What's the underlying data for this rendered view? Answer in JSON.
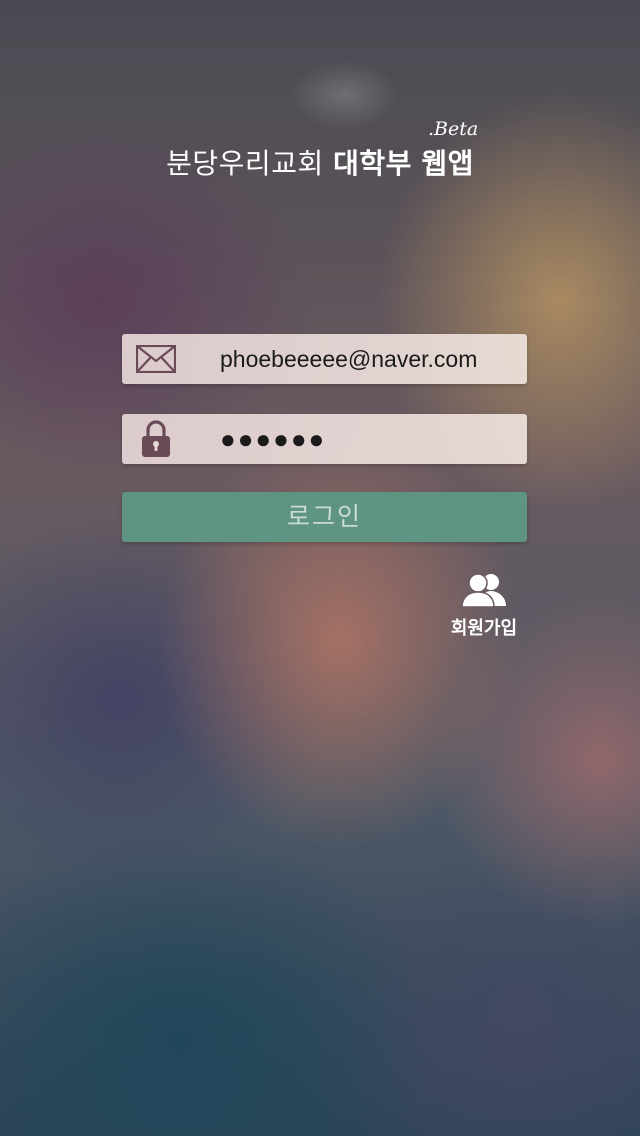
{
  "app": {
    "title_part1": "분당우리교회",
    "title_part2": "대학부",
    "title_part3": "웹앱",
    "beta_badge": ".Beta"
  },
  "login_form": {
    "email_icon": "envelope-icon",
    "email_value": "phoebeeeee@naver.com",
    "password_icon": "padlock-icon",
    "password_masked": "●●●●●●",
    "login_button_label": "로그인"
  },
  "signup": {
    "icon": "people-icon",
    "label": "회원가입"
  },
  "colors": {
    "login_button": "#5f9482",
    "field_background": "#e8dad6",
    "icon_color": "#6a4a56"
  }
}
